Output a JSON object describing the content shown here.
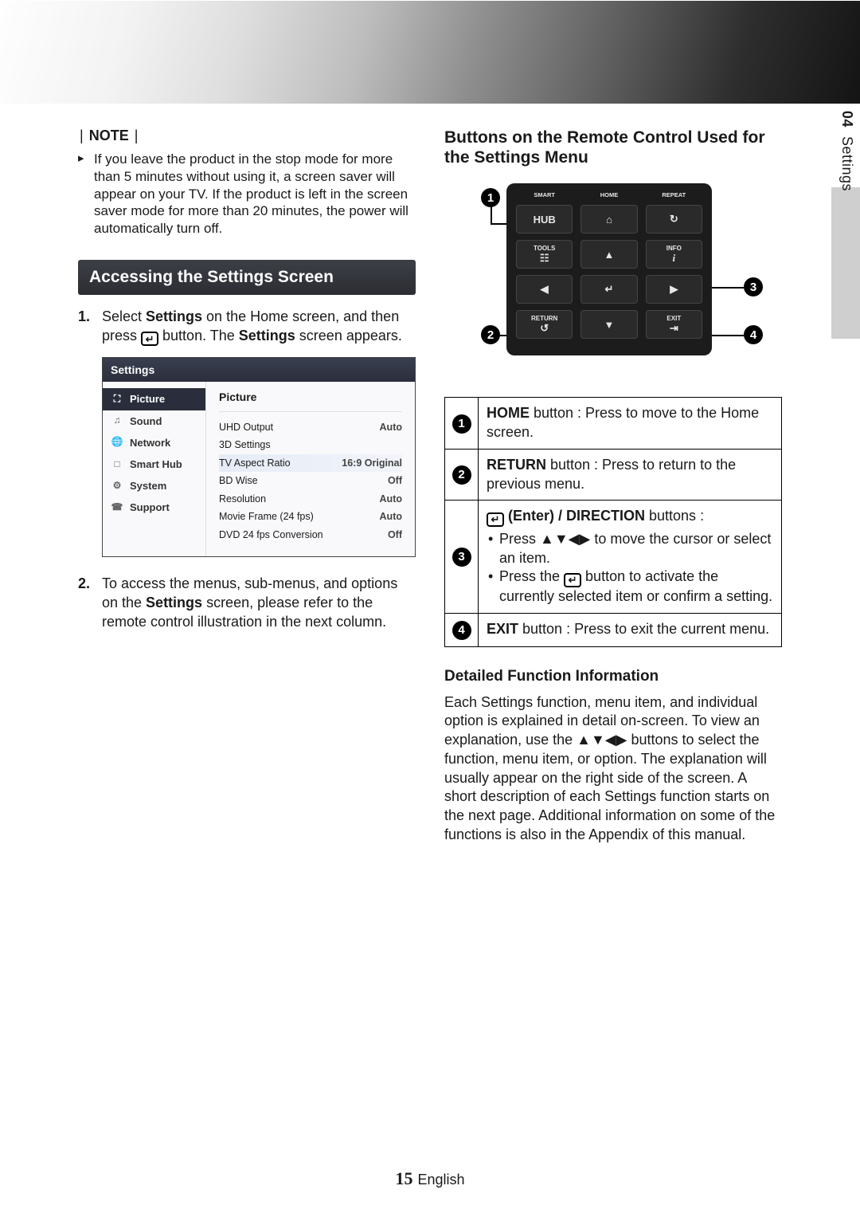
{
  "side_tab": {
    "number": "04",
    "label": "Settings"
  },
  "note": {
    "header_word": "NOTE",
    "pipe": "|",
    "item": "If you leave the product in the stop mode for more than 5 minutes without using it, a screen saver will appear on your TV. If the product is left in the screen saver mode for more than 20 minutes, the power will automatically turn off."
  },
  "section_access": {
    "title": "Accessing the Settings Screen",
    "step1_a": "Select ",
    "step1_b": "Settings",
    "step1_c": " on the Home screen, and then press ",
    "step1_d": " button. The ",
    "step1_e": "Settings",
    "step1_f": " screen appears.",
    "step2_a": "To access the menus, sub-menus, and options on the ",
    "step2_b": "Settings",
    "step2_c": " screen, please refer to the remote control illustration in the next column."
  },
  "settings_panel": {
    "title": "Settings",
    "tabs": [
      {
        "label": "Picture",
        "icon": "pic"
      },
      {
        "label": "Sound",
        "icon": "snd"
      },
      {
        "label": "Network",
        "icon": "net"
      },
      {
        "label": "Smart Hub",
        "icon": "hub"
      },
      {
        "label": "System",
        "icon": "sys"
      },
      {
        "label": "Support",
        "icon": "sup"
      }
    ],
    "heading": "Picture",
    "rows": [
      {
        "k": "UHD Output",
        "v": "Auto"
      },
      {
        "k": "3D Settings",
        "v": ""
      },
      {
        "k": "TV Aspect Ratio",
        "v": "16:9 Original"
      },
      {
        "k": "BD Wise",
        "v": "Off"
      },
      {
        "k": "Resolution",
        "v": "Auto"
      },
      {
        "k": "Movie Frame (24 fps)",
        "v": "Auto"
      },
      {
        "k": "DVD 24 fps Conversion",
        "v": "Off"
      }
    ]
  },
  "right": {
    "heading": "Buttons on the Remote Control Used for the Settings Menu",
    "remote": {
      "top_labels": {
        "smart": "SMART",
        "home": "HOME",
        "repeat": "REPEAT"
      },
      "row1": {
        "hub": "HUB",
        "home_glyph": "⌂",
        "repeat_glyph": ""
      },
      "row2": {
        "tools": "TOOLS",
        "tools_glyph": "☷",
        "up": "▲",
        "info": "INFO",
        "info_glyph": "i"
      },
      "row3": {
        "left": "◀",
        "enter": "↲",
        "right": "▶"
      },
      "row4": {
        "return": "RETURN",
        "return_glyph": "↺",
        "down": "▼",
        "exit": "EXIT",
        "exit_glyph": "⇥"
      }
    },
    "callouts": {
      "c1": "1",
      "c2": "2",
      "c3": "3",
      "c4": "4"
    },
    "table": {
      "r1_num": "1",
      "r1_b": "HOME",
      "r1_t": " button : Press to move to the Home screen.",
      "r2_num": "2",
      "r2_b": "RETURN",
      "r2_t": " button : Press to return to the previous menu.",
      "r3_num": "3",
      "r3_head_b": " (Enter) / DIRECTION",
      "r3_head_t": " buttons :",
      "r3_li1_a": "Press ",
      "r3_li1_arrows": "▲▼◀▶",
      "r3_li1_b": " to move the cursor or select an item.",
      "r3_li2_a": "Press the ",
      "r3_li2_b": " button to activate the currently selected item or confirm a setting.",
      "r4_num": "4",
      "r4_b": "EXIT",
      "r4_t": " button : Press to exit the current menu."
    },
    "detail_head": "Detailed Function Information",
    "detail_para_a": "Each Settings function, menu item, and individual option is explained in detail on-screen. To view an explanation, use the ",
    "detail_arrows": "▲▼◀▶",
    "detail_para_b": " buttons to select the function, menu item, or option. The explanation will usually appear on the right side of the screen. A short description of each Settings function starts on the next page. Additional information on some of the functions is also in the Appendix of this manual."
  },
  "footer": {
    "page": "15",
    "lang": "English"
  }
}
